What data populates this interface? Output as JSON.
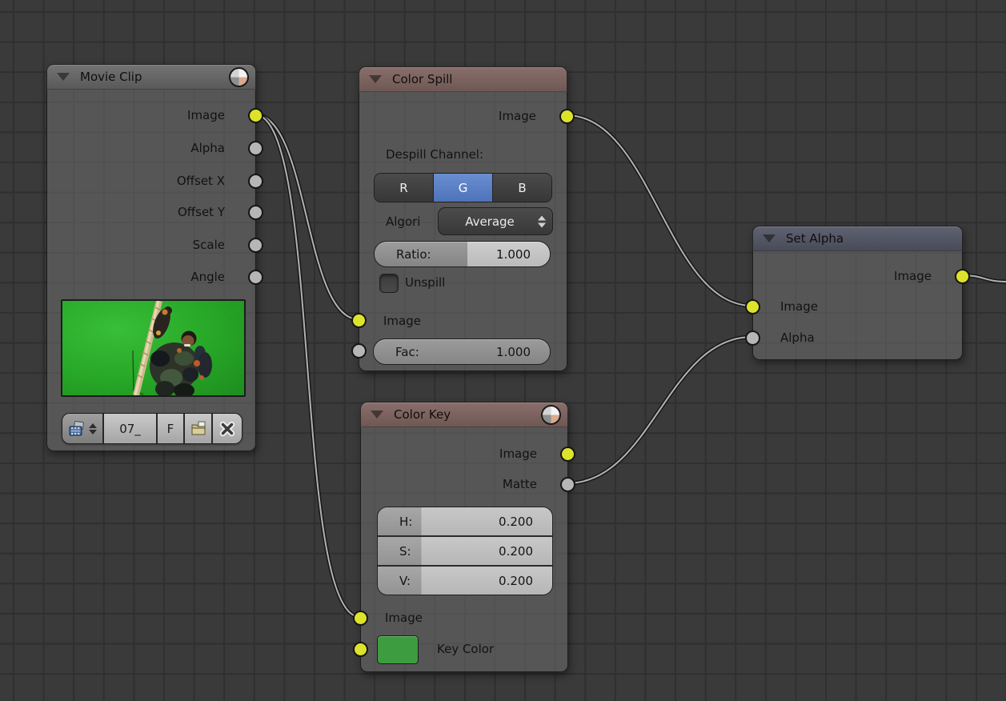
{
  "editor": {
    "type": "blender-compositor-node-editor",
    "colors": {
      "background": "#3a3a3a",
      "grid_line": "#2f2f2f",
      "socket_yellow": "#dde32a",
      "socket_gray": "#b6b6b6",
      "active_channel_blue": "#5d82c6",
      "key_color_swatch": "#3d9c40",
      "header_red": "#7b6260",
      "header_gray": "#666666",
      "header_slate": "#525564"
    }
  },
  "nodes": {
    "movie_clip": {
      "title": "Movie Clip",
      "outputs": [
        {
          "label": "Image",
          "socket": "yellow"
        },
        {
          "label": "Alpha",
          "socket": "gray"
        },
        {
          "label": "Offset X",
          "socket": "gray"
        },
        {
          "label": "Offset Y",
          "socket": "gray"
        },
        {
          "label": "Scale",
          "socket": "gray"
        },
        {
          "label": "Angle",
          "socket": "gray"
        }
      ],
      "preview": "green-screen frame of actor climbing a rope",
      "id_browser": {
        "name": "07_",
        "fake_user": "F"
      }
    },
    "color_spill": {
      "title": "Color Spill",
      "output_label": "Image",
      "despill_channel_label": "Despill Channel:",
      "channels": [
        "R",
        "G",
        "B"
      ],
      "active_channel": "G",
      "algorithm_label": "Algori",
      "algorithm_value": "Average",
      "ratio_label": "Ratio:",
      "ratio_value": "1.000",
      "unspill_label": "Unspill",
      "unspill_checked": false,
      "input_label": "Image",
      "fac_label": "Fac:",
      "fac_value": "1.000"
    },
    "color_key": {
      "title": "Color Key",
      "output_labels": [
        "Image",
        "Matte"
      ],
      "hsv": [
        {
          "label": "H:",
          "value": "0.200"
        },
        {
          "label": "S:",
          "value": "0.200"
        },
        {
          "label": "V:",
          "value": "0.200"
        }
      ],
      "input_label": "Image",
      "key_color_label": "Key Color"
    },
    "set_alpha": {
      "title": "Set Alpha",
      "output_label": "Image",
      "input_labels": [
        "Image",
        "Alpha"
      ]
    }
  }
}
